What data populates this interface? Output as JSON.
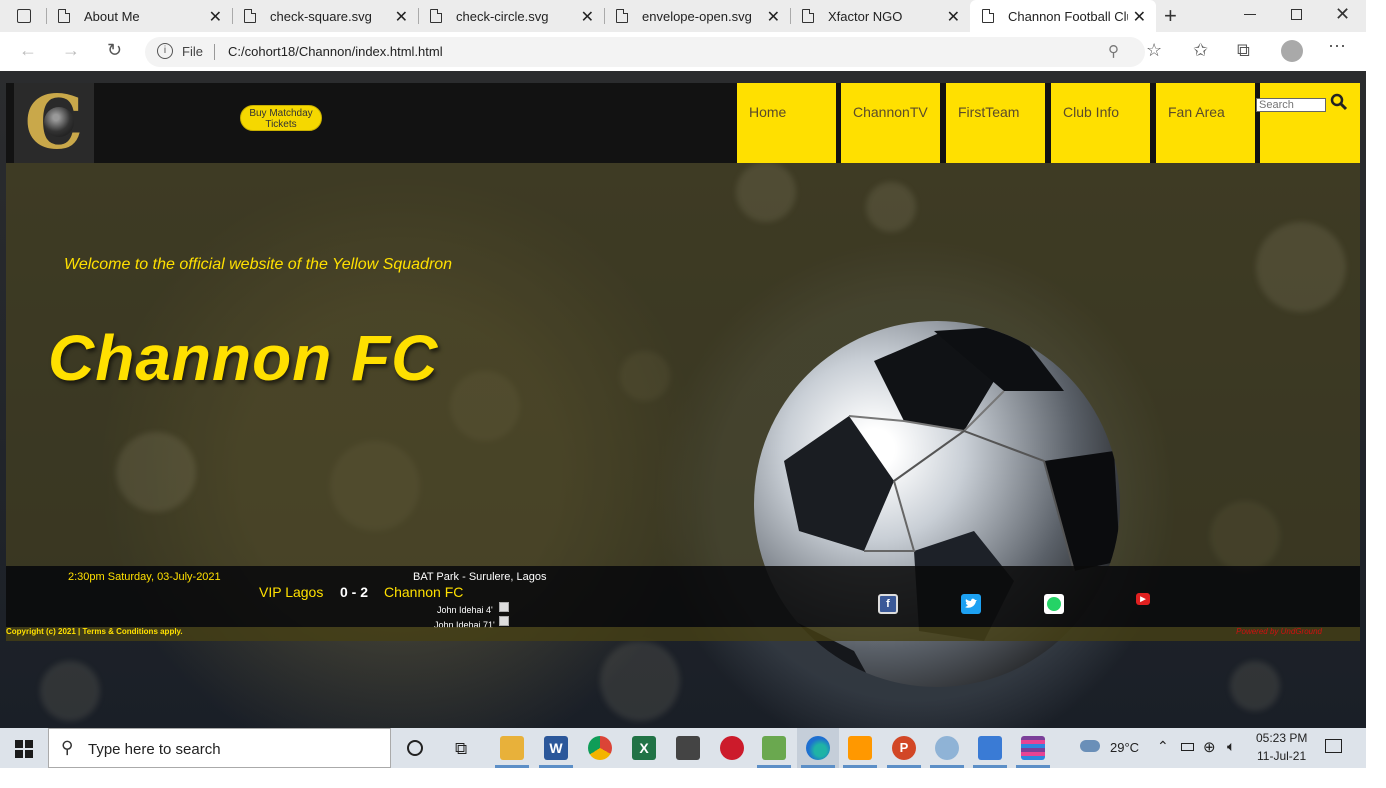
{
  "browser": {
    "tabs": [
      {
        "title": "About Me"
      },
      {
        "title": "check-square.svg"
      },
      {
        "title": "check-circle.svg"
      },
      {
        "title": "envelope-open.svg"
      },
      {
        "title": "Xfactor NGO"
      },
      {
        "title": "Channon Football Clu"
      }
    ],
    "address_prefix": "File",
    "address": "C:/cohort18/Channon/index.html.html"
  },
  "header": {
    "logo_letter": "C",
    "buy_button": "Buy Matchday Tickets",
    "nav": [
      "Home",
      "ChannonTV",
      "FirstTeam",
      "Club Info",
      "Fan Area"
    ],
    "search_placeholder": "Search"
  },
  "hero": {
    "welcome": "Welcome to the official website of the Yellow Squadron",
    "title": "Channon FC"
  },
  "match": {
    "time": "2:30pm Saturday, 03-July-2021",
    "venue": "BAT Park - Surulere, Lagos",
    "home": "VIP Lagos",
    "score": "0 - 2",
    "away": "Channon FC",
    "scorers": [
      "John Idehai 4'",
      "John Idehai 71'"
    ]
  },
  "social": [
    "facebook-icon",
    "twitter-icon",
    "whatsapp-icon",
    "youtube-icon"
  ],
  "footer": {
    "copyright": "Copyright (c) 2021 | Terms & Conditions apply.",
    "powered": "Powered by UndGround"
  },
  "taskbar": {
    "search_placeholder": "Type here to search",
    "weather": "29°C",
    "time": "05:23 PM",
    "date": "11-Jul-21"
  },
  "colors": {
    "accent": "#ffe000",
    "header_bg": "#121212",
    "link_red": "#d01010"
  }
}
